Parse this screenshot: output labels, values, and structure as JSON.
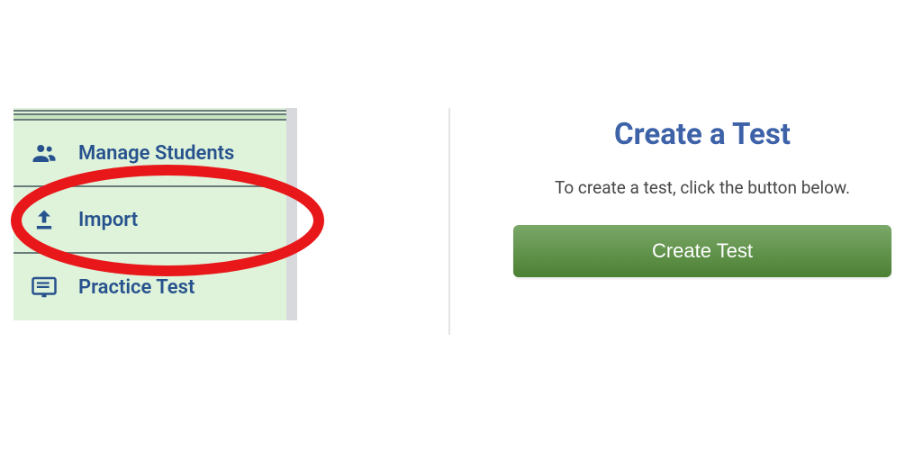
{
  "sidebar": {
    "items": [
      {
        "label": "Manage Students"
      },
      {
        "label": "Import"
      },
      {
        "label": "Practice Test"
      }
    ]
  },
  "create": {
    "title": "Create a Test",
    "subtitle": "To create a test, click the button below.",
    "button_label": "Create Test"
  },
  "annotation": {
    "highlight_color": "#e8171a"
  }
}
